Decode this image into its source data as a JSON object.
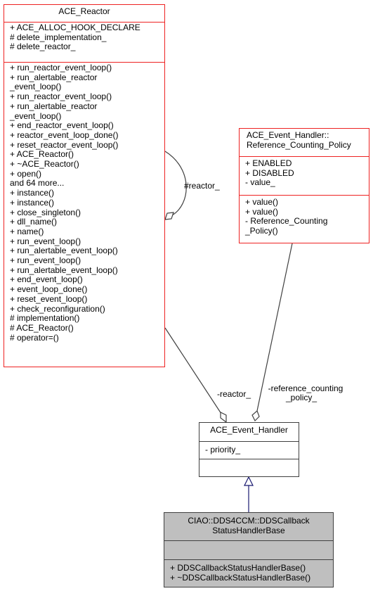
{
  "classes": {
    "ace_reactor": {
      "title": "ACE_Reactor",
      "attributes": [
        "+ ACE_ALLOC_HOOK_DECLARE",
        "# delete_implementation_",
        "# delete_reactor_"
      ],
      "methods": [
        "+ run_reactor_event_loop()",
        "+ run_alertable_reactor",
        "_event_loop()",
        "+ run_reactor_event_loop()",
        "+ run_alertable_reactor",
        "_event_loop()",
        "+ end_reactor_event_loop()",
        "+ reactor_event_loop_done()",
        "+ reset_reactor_event_loop()",
        "+ ACE_Reactor()",
        "+ ~ACE_Reactor()",
        "+ open()",
        "and 64 more...",
        "+ instance()",
        "+ instance()",
        "+ close_singleton()",
        "+ dll_name()",
        "+ name()",
        "+ run_event_loop()",
        "+ run_alertable_event_loop()",
        "+ run_event_loop()",
        "+ run_alertable_event_loop()",
        "+ end_event_loop()",
        "+ event_loop_done()",
        "+ reset_event_loop()",
        "+ check_reconfiguration()",
        "# implementation()",
        "# ACE_Reactor()",
        "# operator=()"
      ]
    },
    "reference_counting_policy": {
      "title_lines": [
        "ACE_Event_Handler::",
        "Reference_Counting_Policy"
      ],
      "attributes": [
        "+ ENABLED",
        "+ DISABLED",
        "- value_"
      ],
      "methods": [
        "+ value()",
        "+ value()",
        "- Reference_Counting",
        "_Policy()"
      ]
    },
    "ace_event_handler": {
      "title": "ACE_Event_Handler",
      "attributes": [
        "- priority_"
      ],
      "methods": []
    },
    "dds_callback_status_handler_base": {
      "title_lines": [
        "CIAO::DDS4CCM::DDSCallback",
        "StatusHandlerBase"
      ],
      "attributes": [],
      "methods": [
        "+ DDSCallbackStatusHandlerBase()",
        "+ ~DDSCallbackStatusHandlerBase()"
      ]
    }
  },
  "edges": {
    "self_reactor_label": "#reactor_",
    "reactor_label": "-reactor_",
    "ref_policy_label_lines": [
      "-reference_counting",
      "_policy_"
    ]
  },
  "colors": {
    "class_border_red": "#ee2222",
    "class_border_dark": "#404040",
    "highlight_fill": "#bfbfbf",
    "inheritance_arrow": "#191970",
    "association_line": "#404040"
  }
}
